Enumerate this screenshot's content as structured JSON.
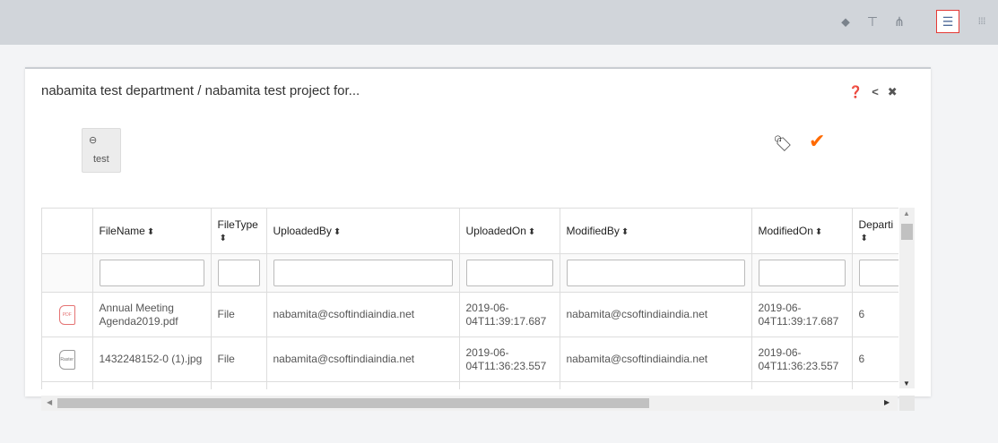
{
  "toolbar": {
    "icons": [
      {
        "name": "tag-icon",
        "glyph": "⬥"
      },
      {
        "name": "filter-icon",
        "glyph": "⊤"
      },
      {
        "name": "hierarchy-icon",
        "glyph": "⋔"
      },
      {
        "name": "list-view-icon",
        "glyph": "☰",
        "active": true
      },
      {
        "name": "grid-view-icon",
        "glyph": "⁞⁞⁞"
      }
    ],
    "active_outline_color": "#e53935"
  },
  "panel": {
    "title": "nabamita test department / nabamita test project for...",
    "help_glyph": "❓",
    "back_glyph": "<",
    "close_glyph": "✖",
    "tag_chip": {
      "glyph": "⊖",
      "label": "test"
    },
    "tags_glyph": "🏷",
    "confirm_glyph": "✔",
    "confirm_color": "#ff6a00"
  },
  "grid": {
    "columns": [
      "FileName",
      "FileType",
      "UploadedBy",
      "UploadedOn",
      "ModifiedBy",
      "ModifiedOn",
      "Departi"
    ],
    "sort_glyph": "⬍",
    "rows": [
      {
        "icon": "PDF",
        "file_name": "Annual Meeting Agenda2019.pdf",
        "file_type": "File",
        "uploaded_by": "nabamita@csoftindiaindia.net",
        "uploaded_on": "2019-06-04T11:39:17.687",
        "modified_by": "nabamita@csoftindiaindia.net",
        "modified_on": "2019-06-04T11:39:17.687",
        "department": "6"
      },
      {
        "icon": "Raster",
        "file_name": "1432248152-0 (1).jpg",
        "file_type": "File",
        "uploaded_by": "nabamita@csoftindiaindia.net",
        "uploaded_on": "2019-06-04T11:36:23.557",
        "modified_by": "nabamita@csoftindiaindia.net",
        "modified_on": "2019-06-04T11:36:23.557",
        "department": "6"
      }
    ]
  },
  "scrollbars": {
    "up": "▲",
    "down": "▼",
    "left": "◀",
    "right": "▶"
  }
}
